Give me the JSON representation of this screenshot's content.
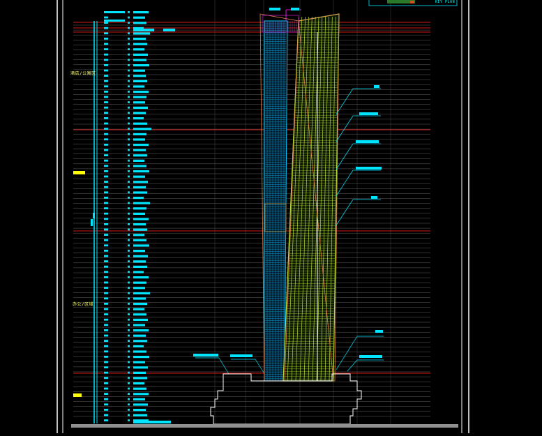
{
  "drawing": {
    "colors": {
      "background": "#000000",
      "frame": "#ffffff",
      "level_line": "#606060",
      "key_level": "#d01818",
      "annotation": "#00e5ff",
      "marker": "#ffff00",
      "facade_green": "#b8d838",
      "facade_cyan": "#00c8ff",
      "crown_orange": "#e08050",
      "magenta": "#d020d0",
      "podium": "#ffffff",
      "ground": "#909090"
    },
    "zones": [
      {
        "label": "酒店/公寓区"
      },
      {
        "label": "办公/区域"
      }
    ],
    "key_plan": {
      "label": "KEY PLAN"
    }
  }
}
